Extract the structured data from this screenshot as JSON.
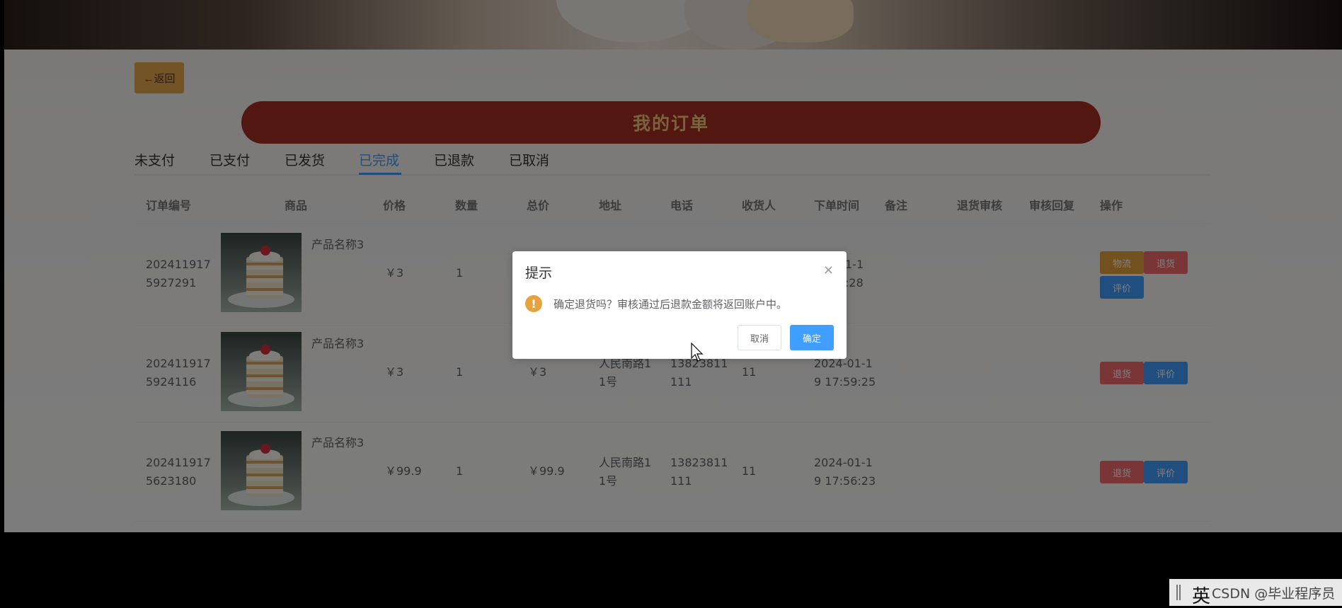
{
  "page": {
    "back_label": "←返回",
    "title": "我的订单"
  },
  "tabs": [
    {
      "label": "未支付"
    },
    {
      "label": "已支付"
    },
    {
      "label": "已发货"
    },
    {
      "label": "已完成",
      "active": true
    },
    {
      "label": "已退款"
    },
    {
      "label": "已取消"
    }
  ],
  "table": {
    "headers": {
      "order_no": "订单编号",
      "product": "商品",
      "price": "价格",
      "qty": "数量",
      "total": "总价",
      "address": "地址",
      "phone": "电话",
      "receiver": "收货人",
      "order_time": "下单时间",
      "remark": "备注",
      "refund_audit": "退货审核",
      "audit_reply": "审核回复",
      "actions": "操作"
    },
    "rows": [
      {
        "order_no_1": "202411917",
        "order_no_2": "5927291",
        "product": "产品名称3",
        "price": "￥3",
        "qty": "1",
        "time_1": "1-1",
        "time_2": ":28",
        "buttons": {
          "logistics": "物流",
          "refund": "退货",
          "review": "评价"
        }
      },
      {
        "order_no_1": "202411917",
        "order_no_2": "5924116",
        "product": "产品名称3",
        "price": "￥3",
        "qty": "1",
        "total": "￥3",
        "address_1": "人民南路1",
        "address_2": "1号",
        "phone_1": "13823811",
        "phone_2": "111",
        "receiver": "11",
        "time_1": "2024-01-1",
        "time_2": "9 17:59:25",
        "buttons": {
          "refund": "退货",
          "review": "评价"
        }
      },
      {
        "order_no_1": "202411917",
        "order_no_2": "5623180",
        "product": "产品名称3",
        "price": "￥99.9",
        "qty": "1",
        "total": "￥99.9",
        "address_1": "人民南路1",
        "address_2": "1号",
        "phone_1": "13823811",
        "phone_2": "111",
        "receiver": "11",
        "time_1": "2024-01-1",
        "time_2": "9 17:56:23",
        "buttons": {
          "refund": "退货",
          "review": "评价"
        }
      }
    ]
  },
  "dialog": {
    "title": "提示",
    "close_icon": "×",
    "warning_icon": "!",
    "message": "确定退货吗？审核通过后退款金额将返回账户中。",
    "cancel_label": "取消",
    "confirm_label": "确定"
  },
  "taskbar": {
    "ime_label": "英",
    "watermark": "CSDN @毕业程序员"
  },
  "colors": {
    "title_bar": "#a42f23",
    "title_text": "#f6c47c",
    "back_button": "#e4a84e",
    "primary": "#409eff",
    "danger": "#f56c6c",
    "warning": "#e6a23c"
  }
}
